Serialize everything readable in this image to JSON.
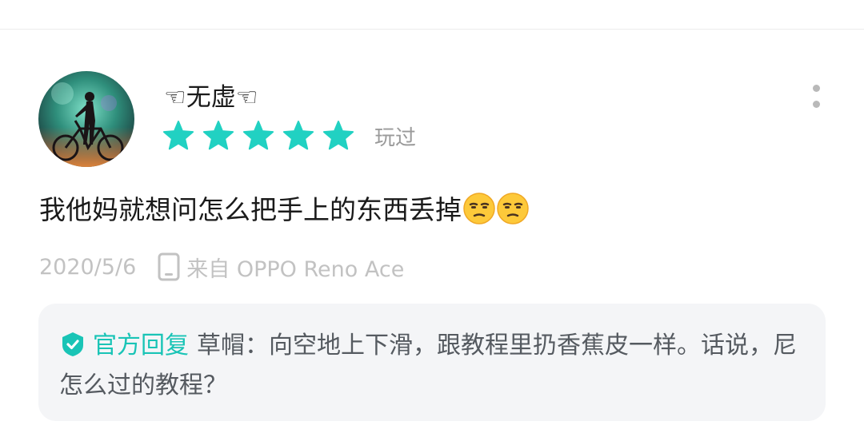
{
  "review": {
    "username": "☜无虚☜",
    "rating": 5,
    "rating_max": 5,
    "status": "玩过",
    "text": "我他妈就想问怎么把手上的东西丢掉",
    "emoji_icons": [
      "unamused-face-icon",
      "unamused-face-icon"
    ],
    "date": "2020/5/6",
    "device_icon": "phone-icon",
    "device": "来自 OPPO Reno Ace"
  },
  "official_reply": {
    "badge_icon": "shield-check-icon",
    "label": "官方回复",
    "text": "草帽：向空地上下滑，跟教程里扔香蕉皮一样。话说，尼怎么过的教程？"
  },
  "colors": {
    "accent": "#19c4b6",
    "star": "#21d1c2",
    "reply_bg": "#f4f5f7",
    "muted_text": "#c2c2c2"
  }
}
